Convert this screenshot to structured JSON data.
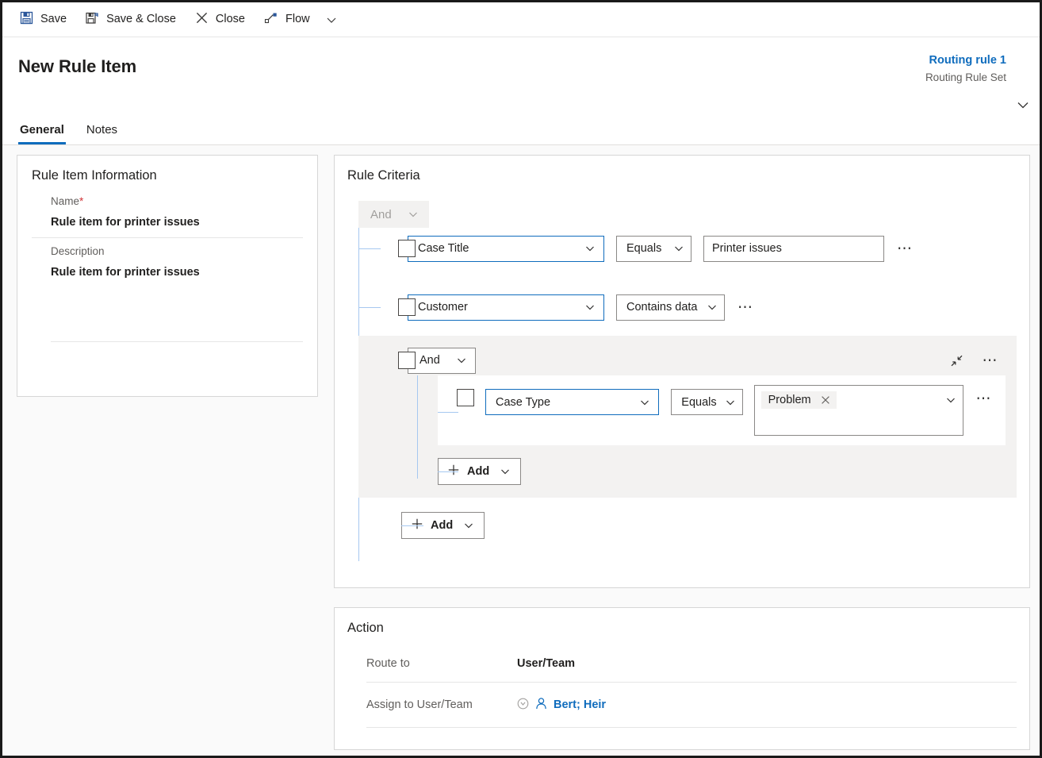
{
  "commandbar": {
    "buttons": [
      {
        "label": "Save",
        "icon": "save-icon"
      },
      {
        "label": "Save & Close",
        "icon": "save-and-close-icon"
      },
      {
        "label": "Close",
        "icon": "close-x-icon"
      },
      {
        "label": "Flow",
        "icon": "flow-icon"
      }
    ],
    "overflow_caret": "chevron-down-icon"
  },
  "header": {
    "title": "New Rule Item",
    "record_name": "Routing rule 1",
    "record_type": "Routing Rule Set",
    "expand_icon": "chevron-down-icon",
    "tabs": [
      {
        "label": "General",
        "active": true
      },
      {
        "label": "Notes",
        "active": false
      }
    ]
  },
  "rule_item_information": {
    "section_title": "Rule Item Information",
    "name_label": "Name",
    "name_required_marker": "*",
    "name_value": "Rule item for printer issues",
    "description_label": "Description",
    "description_value": "Rule item for printer issues"
  },
  "rule_criteria": {
    "section_title": "Rule Criteria",
    "root_operator": "And",
    "rows": [
      {
        "field": "Case Title",
        "operator": "Equals",
        "value": "Printer issues",
        "more_label": "⋯"
      },
      {
        "field": "Customer",
        "operator": "Contains data",
        "value": null,
        "more_label": "⋯"
      }
    ],
    "group": {
      "operator": "And",
      "collapse_icon": "collapse-icon",
      "more_label": "⋯",
      "rows": [
        {
          "field": "Case Type",
          "operator": "Equals",
          "tag": "Problem",
          "tag_remove": "remove-tag-icon",
          "more_label": "⋯"
        }
      ],
      "add_label": "Add"
    },
    "add_label": "Add"
  },
  "action": {
    "section_title": "Action",
    "route_to_label": "Route to",
    "route_to_value": "User/Team",
    "assign_label": "Assign to User/Team",
    "assign_value": "Bert; Heir",
    "assign_lookup_icon": "lookup-circle-icon",
    "assign_person_icon": "person-icon"
  },
  "colors": {
    "accent_blue": "#0f6cbd",
    "field_border_blue": "#0f6cbd",
    "connector_blue": "#a6c8f0",
    "required_red": "#d13438",
    "group_bg": "#f3f2f1",
    "panel_border": "#d6d6d6",
    "text_secondary": "#605e5c"
  }
}
